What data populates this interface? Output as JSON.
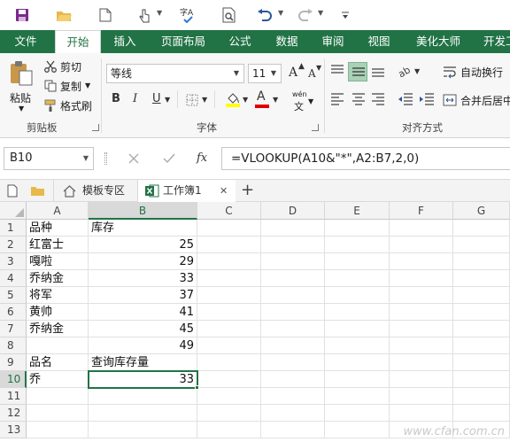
{
  "qat": {
    "icons": [
      "save-icon",
      "open-folder-icon",
      "new-file-icon",
      "touch-mode-icon",
      "spellcheck-icon",
      "print-preview-icon",
      "undo-icon",
      "redo-icon",
      "customize-icon"
    ]
  },
  "tabs": [
    "文件",
    "开始",
    "插入",
    "页面布局",
    "公式",
    "数据",
    "审阅",
    "视图",
    "美化大师",
    "开发工"
  ],
  "ribbon": {
    "clipboard": {
      "paste": "粘贴",
      "cut": "剪切",
      "copy": "复制",
      "format_painter": "格式刷",
      "group": "剪贴板"
    },
    "font": {
      "name": "等线",
      "size": "11",
      "bold": "B",
      "italic": "I",
      "underline": "U",
      "grow": "A",
      "shrink": "A",
      "font_color": "A",
      "wen": "wén",
      "group": "字体"
    },
    "alignment": {
      "wrap_text": "自动换行",
      "merge": "合并后居中",
      "group": "对齐方式"
    }
  },
  "formula_bar": {
    "name_box": "B10",
    "fx": "fx",
    "formula": "=VLOOKUP(A10&\"*\",A2:B7,2,0)"
  },
  "doc_tabs": {
    "template": "模板专区",
    "workbook": "工作簿1",
    "add": "+",
    "close": "✕"
  },
  "sheet": {
    "columns": [
      "A",
      "B",
      "C",
      "D",
      "E",
      "F",
      "G"
    ],
    "rows": [
      "1",
      "2",
      "3",
      "4",
      "5",
      "6",
      "7",
      "8",
      "9",
      "10",
      "11",
      "12",
      "13"
    ],
    "colA": [
      "品种",
      "红富士",
      "嘎啦",
      "乔纳金",
      "将军",
      "黄帅",
      "乔纳金",
      "",
      "品名",
      "乔",
      "",
      "",
      ""
    ],
    "colB": [
      "库存",
      "25",
      "29",
      "33",
      "37",
      "41",
      "45",
      "49",
      "查询库存量",
      "33",
      "",
      "",
      ""
    ],
    "selected_cell": "B10"
  },
  "watermark": "www.cfan.com.cn",
  "colors": {
    "accent": "#217346"
  }
}
